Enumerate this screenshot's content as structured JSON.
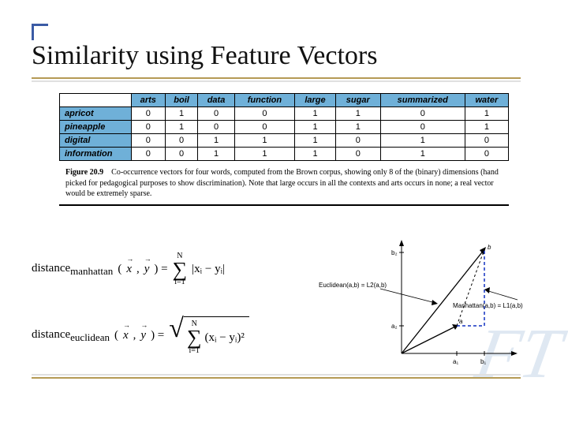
{
  "title": "Similarity using Feature Vectors",
  "table": {
    "cols": [
      "arts",
      "boil",
      "data",
      "function",
      "large",
      "sugar",
      "summarized",
      "water"
    ],
    "rows": [
      "apricot",
      "pineapple",
      "digital",
      "information"
    ],
    "cells": [
      [
        0,
        1,
        0,
        0,
        1,
        1,
        0,
        1
      ],
      [
        0,
        1,
        0,
        0,
        1,
        1,
        0,
        1
      ],
      [
        0,
        0,
        1,
        1,
        1,
        0,
        1,
        0
      ],
      [
        0,
        0,
        1,
        1,
        1,
        0,
        1,
        0
      ]
    ]
  },
  "caption": {
    "label": "Figure 20.9",
    "text": "Co-occurrence vectors for four words, computed from the Brown corpus, showing only 8 of the (binary) dimensions (hand picked for pedagogical purposes to show discrimination). Note that large occurs in all the contexts and arts occurs in none; a real vector would be extremely sparse."
  },
  "formulas": {
    "manhattan_label": "distance",
    "manhattan_sub": "manhattan",
    "euclid_label": "distance",
    "euclid_sub": "euclidean",
    "args": "(",
    "x": "x",
    "y": "y",
    "close": ") =",
    "sum_upper": "N",
    "sum_lower": "i=1",
    "abs_body": "|xᵢ − yᵢ|",
    "sq_body": "(xᵢ − yᵢ)²"
  },
  "diagram": {
    "euclid_label": "Euclidean(a,b) = L2(a,b)",
    "manhattan_label": "Manhattan(a,b) = L1(a,b)",
    "b2": "b₂",
    "a2": "a₂",
    "a1": "a₁",
    "b1": "b₁",
    "va": "a",
    "vb": "b"
  },
  "chart_data": {
    "type": "table",
    "title": "Co-occurrence vectors (Figure 20.9)",
    "columns": [
      "arts",
      "boil",
      "data",
      "function",
      "large",
      "sugar",
      "summarized",
      "water"
    ],
    "rows": [
      "apricot",
      "pineapple",
      "digital",
      "information"
    ],
    "values": [
      [
        0,
        1,
        0,
        0,
        1,
        1,
        0,
        1
      ],
      [
        0,
        1,
        0,
        0,
        1,
        1,
        0,
        1
      ],
      [
        0,
        0,
        1,
        1,
        1,
        0,
        1,
        0
      ],
      [
        0,
        0,
        1,
        1,
        1,
        0,
        1,
        0
      ]
    ]
  }
}
